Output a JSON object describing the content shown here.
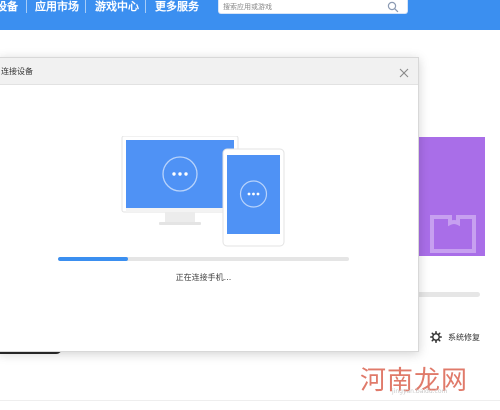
{
  "topbar": {
    "nav": [
      {
        "label": "设备"
      },
      {
        "label": "应用市场"
      },
      {
        "label": "游戏中心"
      },
      {
        "label": "更多服务"
      }
    ],
    "search": {
      "placeholder": "搜索应用或游戏",
      "icon": "search-icon"
    }
  },
  "background": {
    "repair": {
      "label": "系统修复",
      "icon": "gear-icon"
    },
    "watermark": {
      "text": "河南龙网",
      "sub": "jingyan.baidu.com"
    }
  },
  "dialog": {
    "title": "连接设备",
    "close_icon": "close-icon",
    "status_text": "正在连接手机...",
    "progress": 0.24
  },
  "colors": {
    "brand": "#3b8ff0",
    "screen": "#4f92f5",
    "card": "#a96ee8"
  }
}
